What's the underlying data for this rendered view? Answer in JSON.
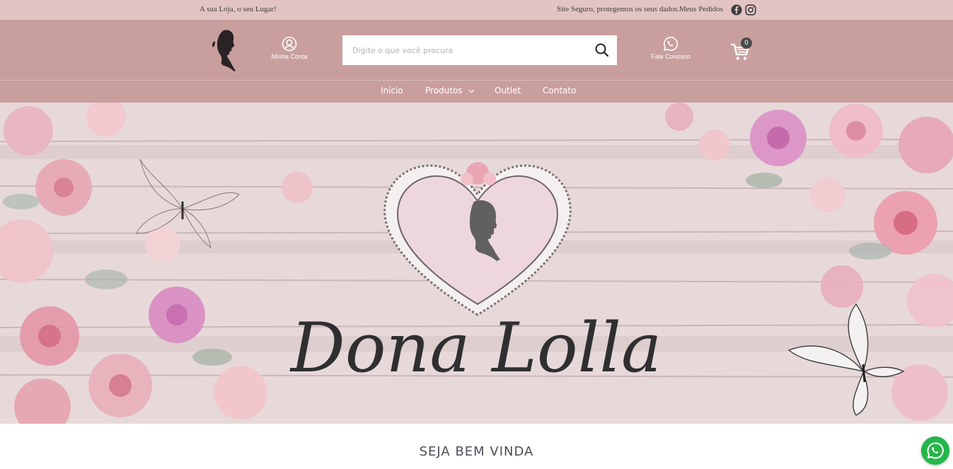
{
  "topbar": {
    "tagline": "A sua Loja, o seu Lugar!",
    "secure": "Site Seguro, protegemos os seus dados.",
    "orders": "Meus Pedidos",
    "social": [
      "facebook-icon",
      "instagram-icon"
    ]
  },
  "header": {
    "account_label": "Minha Conta",
    "search_placeholder": "Digite o que você procura",
    "contact_label": "Fale Conosco",
    "cart_count": "0"
  },
  "nav": {
    "items": [
      "Início",
      "Produtos",
      "Outlet",
      "Contato"
    ]
  },
  "hero": {
    "brand": "Dona Lolla"
  },
  "welcome": "SEJA BEM VINDA",
  "colors": {
    "topbar": "#e3c4c5",
    "header": "#c99f9e",
    "accent_text": "#4a4f58",
    "whatsapp": "#25b64a"
  }
}
